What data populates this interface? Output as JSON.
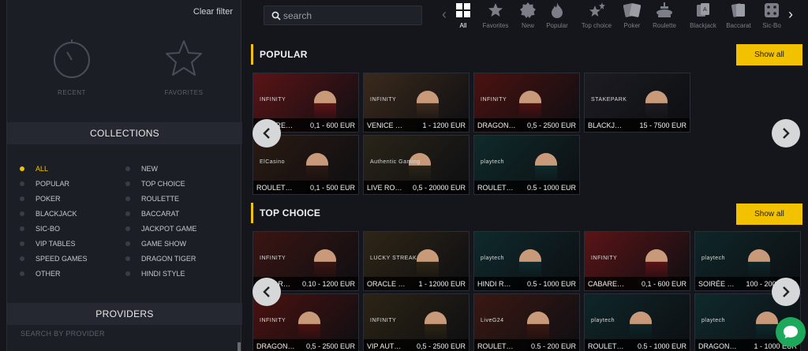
{
  "sidebar": {
    "clear_filter": "Clear filter",
    "recent_label": "RECENT",
    "favorites_label": "FAVORITES",
    "collections_title": "COLLECTIONS",
    "collections_left": [
      {
        "label": "ALL",
        "active": true
      },
      {
        "label": "POPULAR"
      },
      {
        "label": "POKER"
      },
      {
        "label": "BLACKJACK"
      },
      {
        "label": "SIC-BO"
      },
      {
        "label": "VIP TABLES"
      },
      {
        "label": "SPEED GAMES"
      },
      {
        "label": "OTHER"
      }
    ],
    "collections_right": [
      {
        "label": "NEW"
      },
      {
        "label": "TOP CHOICE"
      },
      {
        "label": "ROULETTE"
      },
      {
        "label": "BACCARAT"
      },
      {
        "label": "JACKPOT GAME"
      },
      {
        "label": "GAME SHOW"
      },
      {
        "label": "DRAGON TIGER"
      },
      {
        "label": "HINDI STYLE"
      }
    ],
    "providers_title": "PROVIDERS",
    "provider_search_placeholder": "SEARCH BY PROVIDER"
  },
  "search": {
    "placeholder": "search"
  },
  "categories": [
    {
      "label": "All",
      "icon": "grid-icon",
      "active": true
    },
    {
      "label": "Favorites",
      "icon": "star-icon"
    },
    {
      "label": "New",
      "icon": "new-badge-icon"
    },
    {
      "label": "Popular",
      "icon": "fire-icon"
    },
    {
      "label": "Top choice",
      "icon": "sparkle-star-icon"
    },
    {
      "label": "Poker",
      "icon": "cards-icon"
    },
    {
      "label": "Roulette",
      "icon": "roulette-icon"
    },
    {
      "label": "Blackjack",
      "icon": "blackjack-icon"
    },
    {
      "label": "Baccarat",
      "icon": "baccarat-icon"
    },
    {
      "label": "Sic-Bo",
      "icon": "dice-icon"
    }
  ],
  "popular": {
    "title": "POPULAR",
    "show_all": "Show all",
    "cards": [
      {
        "name": "CABARE…",
        "limits": "0,1 - 600 EUR",
        "provider": "INFINITY",
        "bg": "#5a1416"
      },
      {
        "name": "VENICE …",
        "limits": "1 - 1200 EUR",
        "provider": "INFINITY",
        "bg": "#3b2a1c"
      },
      {
        "name": "DRAGON…",
        "limits": "0,5 - 2500 EUR",
        "provider": "INFINITY",
        "bg": "#4a1210"
      },
      {
        "name": "BLACKJ…",
        "limits": "15 - 7500 EUR",
        "provider": "STAKEPARK",
        "bg": "#1c1c22"
      },
      {
        "name": "ROULET…",
        "limits": "0,1 - 500 EUR",
        "provider": "ElCasino",
        "bg": "#2a1a12"
      },
      {
        "name": "LIVE RO…",
        "limits": "0,5 - 20000 EUR",
        "provider": "Authentic Gaming",
        "bg": "#2a2418"
      },
      {
        "name": "ROULET…",
        "limits": "0.5 - 1000 EUR",
        "provider": "playtech",
        "bg": "#0f2a2a"
      }
    ]
  },
  "top_choice": {
    "title": "TOP CHOICE",
    "show_all": "Show all",
    "cards": [
      {
        "name": "AUTO R…",
        "limits": "0.10 - 1200 EUR",
        "provider": "INFINITY",
        "bg": "#3a1512"
      },
      {
        "name": "ORACLE …",
        "limits": "1 - 12000 EUR",
        "provider": "LUCKY STREAK",
        "bg": "#2e2516"
      },
      {
        "name": "HINDI R…",
        "limits": "0.5 - 1000 EUR",
        "provider": "playtech",
        "bg": "#0e2a2c"
      },
      {
        "name": "CABARE…",
        "limits": "0,1 - 600 EUR",
        "provider": "INFINITY",
        "bg": "#5a1416"
      },
      {
        "name": "SOIRÉE …",
        "limits": "100 - 2000 EUR",
        "provider": "playtech",
        "bg": "#0e2628"
      },
      {
        "name": "DRAGON…",
        "limits": "0,5 - 2500 EUR",
        "provider": "INFINITY",
        "bg": "#4a1210"
      },
      {
        "name": "VIP AUT…",
        "limits": "0,5 - 2500 EUR",
        "provider": "INFINITY",
        "bg": "#2c2414"
      },
      {
        "name": "ROULET…",
        "limits": "0.5 - 200 EUR",
        "provider": "LiveG24",
        "bg": "#3a1812"
      },
      {
        "name": "ROULET…",
        "limits": "0.5 - 1000 EUR",
        "provider": "playtech",
        "bg": "#0e2628"
      },
      {
        "name": "DRAGON…",
        "limits": "1 - 1000 EUR",
        "provider": "playtech",
        "bg": "#0e2a2c"
      }
    ]
  }
}
